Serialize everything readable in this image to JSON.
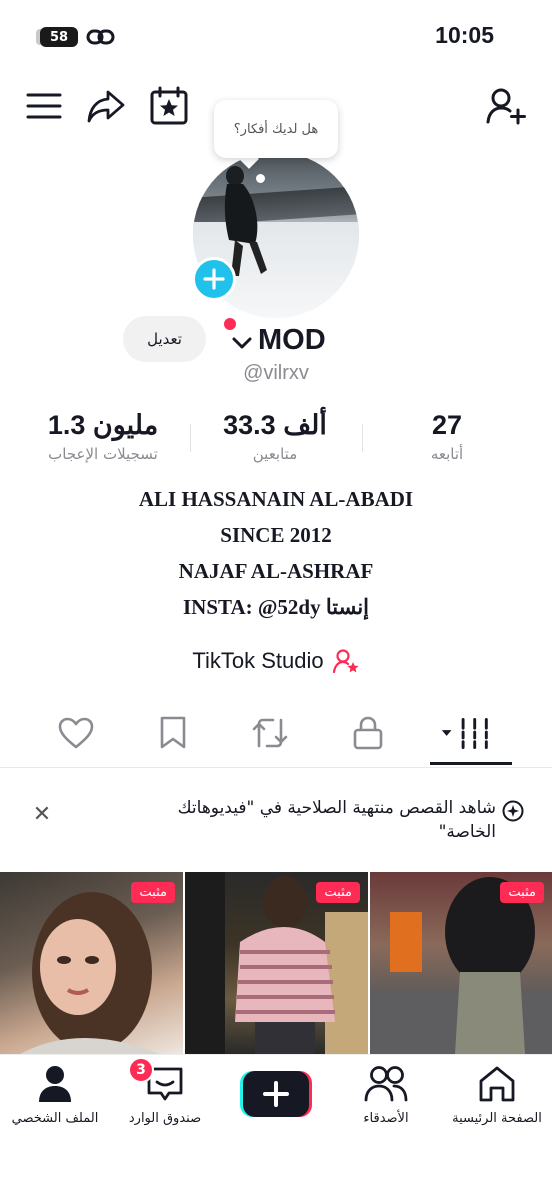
{
  "status_bar": {
    "battery": "58",
    "time": "10:05"
  },
  "profile": {
    "ideas_bubble": "هل لديك أفكار؟",
    "edit_label": "تعديل",
    "name": "MOD",
    "handle": "@vilrxv",
    "stats": [
      {
        "value": "1.3 مليون",
        "label": "تسجيلات الإعجاب"
      },
      {
        "value": "33.3 ألف",
        "label": "متابعين"
      },
      {
        "value": "27",
        "label": "أتابعه"
      }
    ],
    "bio": [
      "ALI HASSANAIN AL-ABADI",
      "SINCE 2012",
      "NAJAF AL-ASHRAF",
      "INSTA: @52dy إنستا"
    ],
    "studio_label": "TikTok Studio"
  },
  "banner": {
    "text": "شاهد القصص منتهية الصلاحية في \"فيديوهاتك الخاصة\""
  },
  "videos": [
    {
      "pin_label": "مثبت"
    },
    {
      "pin_label": "مثبت"
    },
    {
      "pin_label": "مثبت"
    }
  ],
  "bottom_nav": {
    "profile": "الملف الشخصي",
    "inbox": "صندوق الوارد",
    "inbox_badge": "3",
    "friends": "الأصدقاء",
    "home": "الصفحة الرئيسية"
  },
  "colors": {
    "accent": "#fe2c55",
    "add_button": "#20c1ea",
    "text": "#161823",
    "muted": "#8a8b91"
  }
}
